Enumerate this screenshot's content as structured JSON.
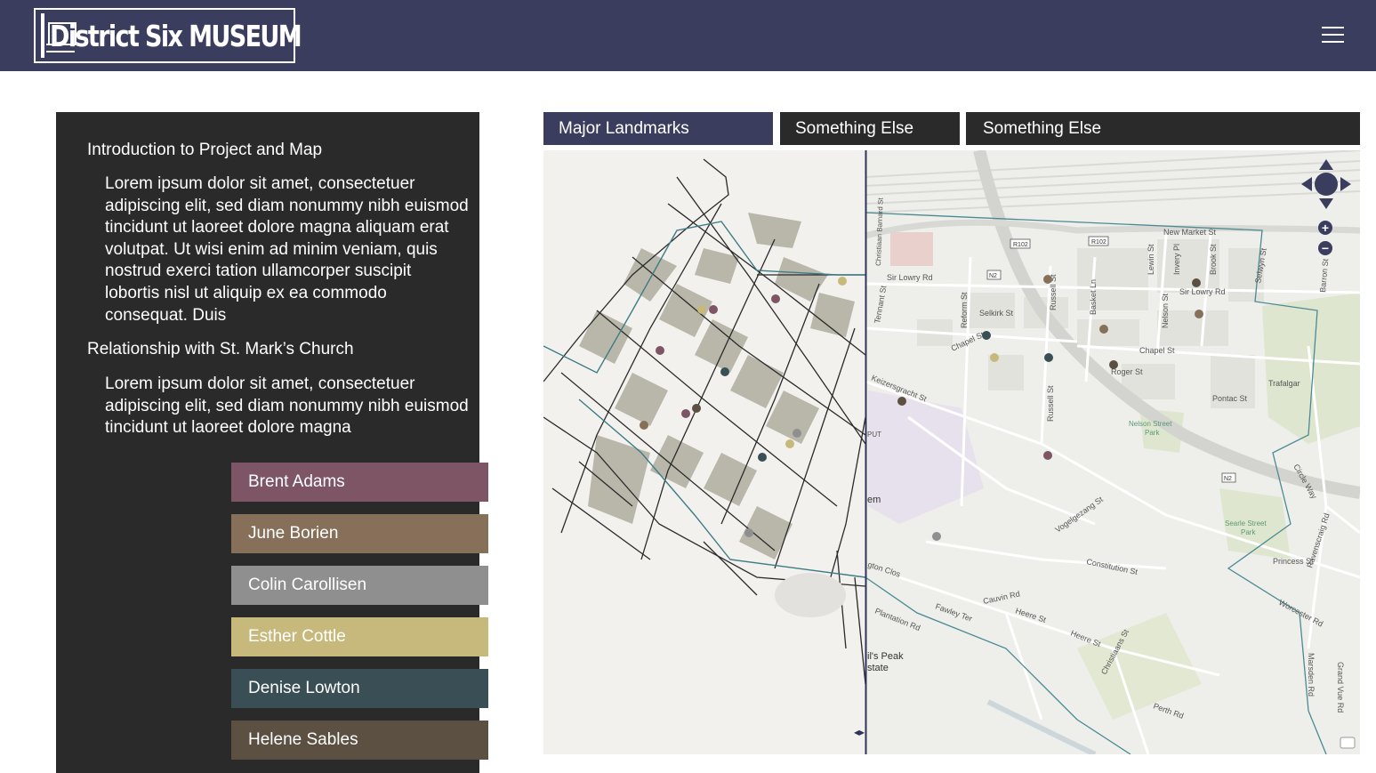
{
  "header": {
    "logo_text": "District Six MUSEUM",
    "bg": "#3a3d5e"
  },
  "sidebar": {
    "sections": [
      {
        "title": "Introduction to Project and Map",
        "body": "Lorem ipsum dolor sit amet, consectetuer adipiscing elit, sed diam nonummy nibh euismod tincidunt ut laoreet dolore magna aliquam erat volutpat. Ut wisi enim ad minim veniam, quis nostrud exerci tation ullamcorper suscipit lobortis nisl ut aliquip ex ea commodo consequat. Duis"
      },
      {
        "title": "Relationship with St. Mark’s Church",
        "body": "Lorem ipsum dolor sit amet, consectetuer adipiscing elit, sed diam nonummy nibh euismod tincidunt ut laoreet dolore magna"
      }
    ]
  },
  "people": [
    {
      "name": "Brent Adams",
      "color": "#7d5564"
    },
    {
      "name": "June Borien",
      "color": "#86705a"
    },
    {
      "name": "Colin Carollisen",
      "color": "#8f8f8f"
    },
    {
      "name": "Esther Cottle",
      "color": "#c7b97c"
    },
    {
      "name": "Denise Lowton",
      "color": "#3a4f55"
    },
    {
      "name": "Helene Sables",
      "color": "#5c5043"
    }
  ],
  "tabs": [
    {
      "label": "Major Landmarks",
      "color": "#3a3d5e"
    },
    {
      "label": "Something Else",
      "color": "#2a2a2a"
    },
    {
      "label": "Something Else",
      "color": "#2a2a2a"
    }
  ],
  "map": {
    "street_labels": {
      "new_market": "New Market St",
      "sir_lowry_w": "Sir Lowry Rd",
      "sir_lowry_e": "Sir Lowry Rd",
      "selkirk": "Selkirk St",
      "chapel_w": "Chapel St",
      "chapel_e": "Chapel St",
      "roger": "Roger St",
      "pontac": "Pontac St",
      "trafalgar": "Trafalgar",
      "nelson_park": "Nelson Street",
      "nelson_park2": "Park",
      "keizersgracht": "Keizersgracht St",
      "vogelgezang": "Vogelgezang St",
      "constitution": "Constitution St",
      "cauvin": "Cauvin Rd",
      "heere_w": "Heere St",
      "heere_e": "Heere St",
      "fawley": "Fawley Ter",
      "plantation": "Plantation Rd",
      "christiaans": "Christiaans St",
      "perth": "Perth Rd",
      "searle": "Searle Street",
      "searle2": "Park",
      "princess": "Princess St",
      "worcester": "Worcester Rd",
      "ravenscraig": "Ravenscraig Rd",
      "marsden": "Marsden Rd",
      "grand_vue": "Grand Vue Rd",
      "devils_peak": "il's Peak",
      "devils_peak2": "state",
      "em": "em",
      "put": "PUT",
      "gron": "gton Clos",
      "russell_n": "Russell St",
      "russell_s": "Russell St",
      "reform": "Reform St",
      "basket": "Basket Ln",
      "lewin": "Lewin St",
      "invery": "Invery Pl",
      "brook": "Brook St",
      "nelson_st": "Nelson St",
      "selwyn": "Selwyn St",
      "barton": "Barron St",
      "christian_barnard": "Christiaan Barnard St",
      "tennant": "Tennant St",
      "circle": "Circle Way",
      "r102a": "R102",
      "r102b": "R102",
      "n2a": "N2",
      "n2b": "N2"
    },
    "zoom_in": "+",
    "zoom_out": "−",
    "swipe_glyph": "◂▸"
  }
}
